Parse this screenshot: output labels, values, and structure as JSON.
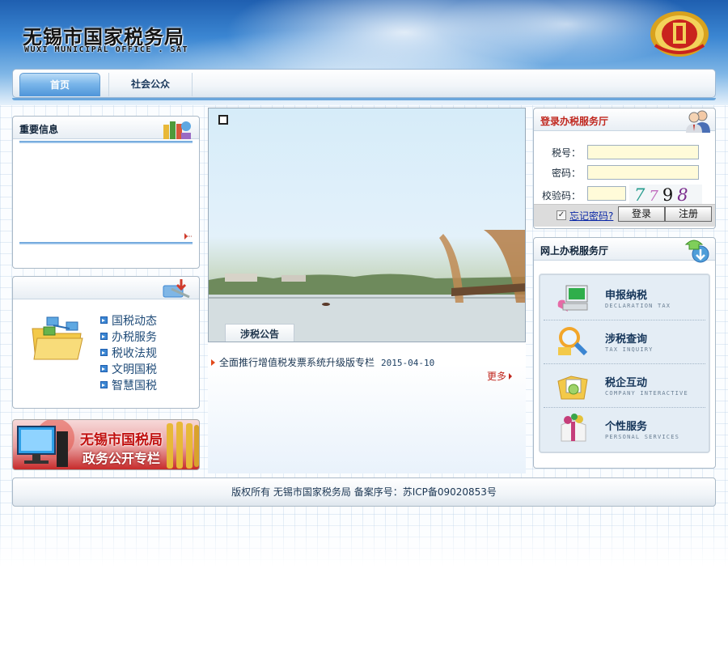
{
  "header": {
    "site_title_cn": "无锡市国家税务局",
    "site_title_en": "WUXI MUNICIPAL OFFICE . SAT",
    "emblem_icon": "tax-emblem-icon"
  },
  "nav": {
    "tabs": [
      {
        "label": "首页",
        "active": true
      },
      {
        "label": "社会公众",
        "active": false
      }
    ]
  },
  "important_info": {
    "title": "重要信息",
    "icon": "books-icon"
  },
  "quick_links": {
    "icon": "folder-network-icon",
    "items": [
      "国税动态",
      "办税服务",
      "税收法规",
      "文明国税",
      "智慧国税"
    ]
  },
  "banner": {
    "line1": "无锡市国税局",
    "line2": "政务公开专栏"
  },
  "center": {
    "photo_tab": "涉税公告",
    "notices": [
      {
        "title": "全面推行增值税发票系统升级版专栏",
        "date": "2015-04-10"
      }
    ],
    "more_label": "更多"
  },
  "login": {
    "title": "登录办税服务厅",
    "tax_id_label": "税号：",
    "password_label": "密码：",
    "captcha_label": "校验码：",
    "captcha_digits": [
      "7",
      "7",
      "9",
      "8"
    ],
    "forgot_label": "忘记密码?",
    "login_button": "登录",
    "register_button": "注册"
  },
  "online_hall": {
    "title": "网上办税服务厅",
    "services": [
      {
        "cn": "申报纳税",
        "en": "DECLARATION TAX"
      },
      {
        "cn": "涉税查询",
        "en": "TAX INQUIRY"
      },
      {
        "cn": "税企互动",
        "en": "COMPANY INTERACTIVE"
      },
      {
        "cn": "个性服务",
        "en": "PERSONAL SERVICES"
      }
    ]
  },
  "footer": {
    "text": "版权所有 无锡市国家税务局 备案序号：苏ICP备09020853号"
  },
  "colors": {
    "brand_blue": "#3b86d2",
    "accent_red": "#c0271e",
    "input_bg": "#fffbd9"
  }
}
